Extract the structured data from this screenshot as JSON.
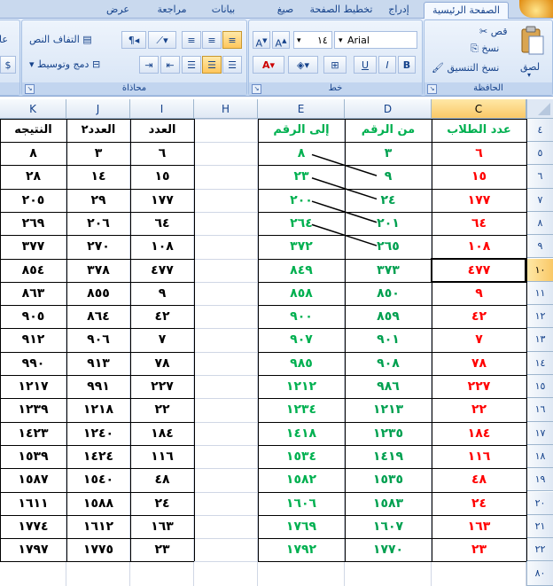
{
  "tabs": [
    {
      "label": "الصفحة الرئيسية",
      "active": true
    },
    {
      "label": "إدراج"
    },
    {
      "label": "تخطيط الصفحة"
    },
    {
      "label": "صيغ"
    },
    {
      "label": "بيانات"
    },
    {
      "label": "مراجعة"
    },
    {
      "label": "عرض"
    }
  ],
  "ribbon": {
    "clipboard": {
      "label": "الحافظة",
      "paste": "لصق",
      "cut": "قص",
      "copy": "نسخ",
      "format_painter": "نسخ التنسيق"
    },
    "font": {
      "label": "خط",
      "font_name": "Arial",
      "font_size": "١٤",
      "bold": "B",
      "italic": "I",
      "underline": "U"
    },
    "alignment": {
      "label": "محاذاة",
      "wrap_text": "التفاف النص",
      "merge_center": "دمج وتوسيط"
    },
    "number": {
      "label_partial": "عا"
    }
  },
  "columns": [
    "C",
    "D",
    "E",
    "H",
    "I",
    "J",
    "K"
  ],
  "row_numbers": [
    "٤",
    "٥",
    "٦",
    "٧",
    "٨",
    "٩",
    "١٠",
    "١١",
    "١٢",
    "١٣",
    "١٤",
    "١٥",
    "١٦",
    "١٧",
    "١٨",
    "١٩",
    "٢٠",
    "٢١",
    "٢٢",
    "٨٠"
  ],
  "headers": {
    "C": "عدد الطلاب",
    "D": "من الرقم",
    "E": "إلى الرقم",
    "I": "العدد",
    "J": "العدد٢",
    "K": "النتيجه"
  },
  "table_left": {
    "C": [
      "٦",
      "١٥",
      "١٧٧",
      "٦٤",
      "١٠٨",
      "٤٧٧",
      "٩",
      "٤٢",
      "٧",
      "٧٨",
      "٢٢٧",
      "٢٢",
      "١٨٤",
      "١١٦",
      "٤٨",
      "٢٤",
      "١٦٣",
      "٢٣"
    ],
    "D": [
      "٣",
      "٩",
      "٢٤",
      "٢٠١",
      "٢٦٥",
      "٣٧٣",
      "٨٥٠",
      "٨٥٩",
      "٩٠١",
      "٩٠٨",
      "٩٨٦",
      "١٢١٣",
      "١٢٣٥",
      "١٤١٩",
      "١٥٣٥",
      "١٥٨٣",
      "١٦٠٧",
      "١٧٧٠"
    ],
    "E": [
      "٨",
      "٢٣",
      "٢٠٠",
      "٢٦٤",
      "٣٧٢",
      "٨٤٩",
      "٨٥٨",
      "٩٠٠",
      "٩٠٧",
      "٩٨٥",
      "١٢١٢",
      "١٢٣٤",
      "١٤١٨",
      "١٥٣٤",
      "١٥٨٢",
      "١٦٠٦",
      "١٧٦٩",
      "١٧٩٢"
    ]
  },
  "table_right": {
    "I": [
      "٦",
      "١٥",
      "١٧٧",
      "٦٤",
      "١٠٨",
      "٤٧٧",
      "٩",
      "٤٢",
      "٧",
      "٧٨",
      "٢٢٧",
      "٢٢",
      "١٨٤",
      "١١٦",
      "٤٨",
      "٢٤",
      "١٦٣",
      "٢٣"
    ],
    "J": [
      "٣",
      "١٤",
      "٢٩",
      "٢٠٦",
      "٢٧٠",
      "٣٧٨",
      "٨٥٥",
      "٨٦٤",
      "٩٠٦",
      "٩١٣",
      "٩٩١",
      "١٢١٨",
      "١٢٤٠",
      "١٤٢٤",
      "١٥٤٠",
      "١٥٨٨",
      "١٦١٢",
      "١٧٧٥"
    ],
    "K": [
      "٨",
      "٢٨",
      "٢٠٥",
      "٢٦٩",
      "٣٧٧",
      "٨٥٤",
      "٨٦٣",
      "٩٠٥",
      "٩١٢",
      "٩٩٠",
      "١٢١٧",
      "١٢٣٩",
      "١٤٢٣",
      "١٥٣٩",
      "١٥٨٧",
      "١٦١١",
      "١٧٧٤",
      "١٧٩٧"
    ]
  },
  "colors": {
    "C_text": "#ff0000",
    "D_text": "#00a050",
    "E_text": "#00b050",
    "header_green": "#00b050",
    "selected_row_header": "#f9c867"
  },
  "selected_cell": "C10"
}
